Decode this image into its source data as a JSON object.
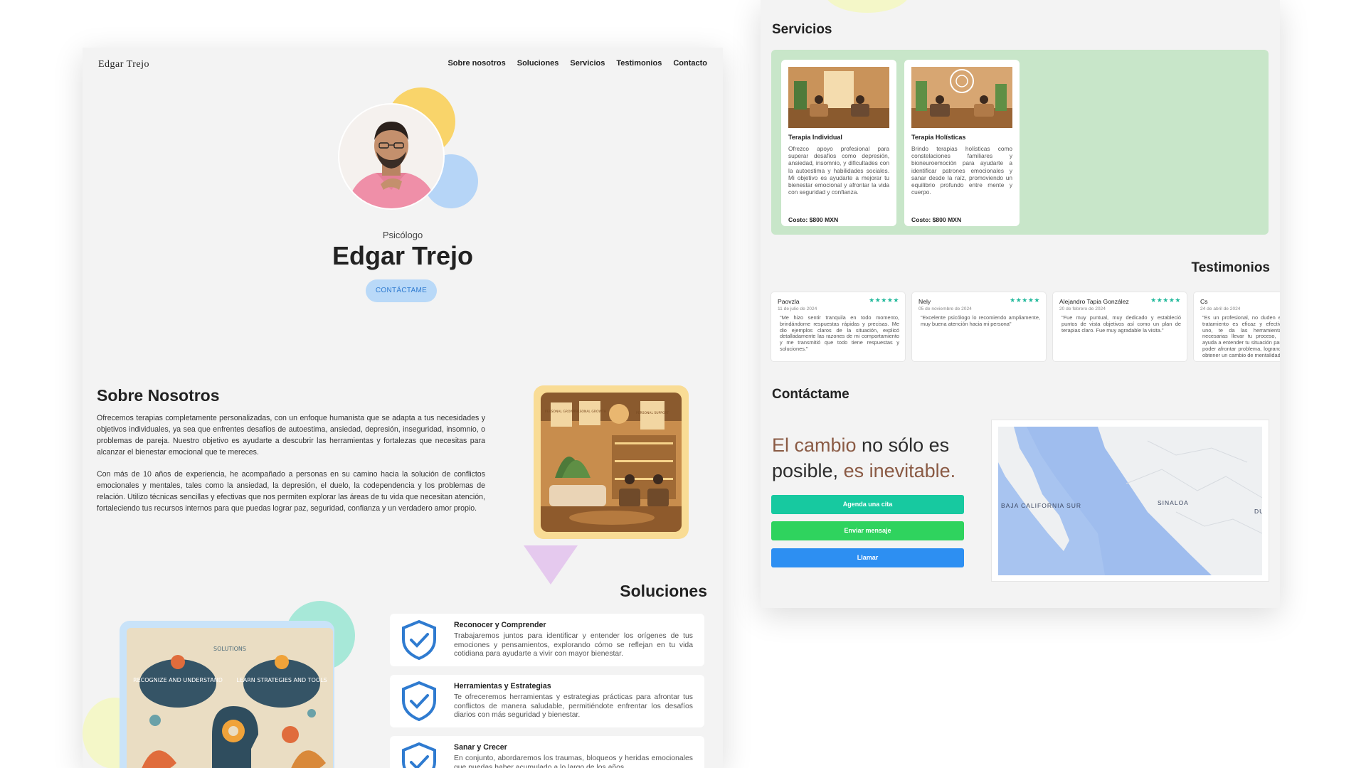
{
  "left": {
    "logo": "Edgar Trejo",
    "nav": [
      "Sobre nosotros",
      "Soluciones",
      "Servicios",
      "Testimonios",
      "Contacto"
    ],
    "hero": {
      "role": "Psicólogo",
      "name": "Edgar Trejo",
      "button": "CONTÁCTAME"
    },
    "about": {
      "title": "Sobre Nosotros",
      "p1": "Ofrecemos terapias completamente personalizadas, con un enfoque humanista que se adapta a tus necesidades y objetivos individuales, ya sea que enfrentes desafíos de autoestima, ansiedad, depresión, inseguridad, insomnio, o problemas de pareja. Nuestro objetivo es ayudarte a descubrir las herramientas y fortalezas que necesitas para alcanzar el bienestar emocional que te mereces.",
      "p2": "Con más de 10 años de experiencia, he acompañado a personas en su camino hacia la solución de conflictos emocionales y mentales, tales como la ansiedad, la depresión, el duelo, la codependencia y los problemas de relación. Utilizo técnicas sencillas y efectivas que nos permiten explorar las áreas de tu vida que necesitan atención, fortaleciendo tus recursos internos para que puedas lograr paz, seguridad, confianza y un verdadero amor propio.",
      "image_signs": [
        "PERSONAL GROWTH",
        "PERSONAL GROWTH",
        "PERSONAL SUPPORT"
      ]
    },
    "solutions": {
      "title": "Soluciones",
      "poster": {
        "heading": "SOLUTIONS",
        "left": "RECOGNIZE AND UNDERSTAND",
        "right": "LEARN STRATEGIES AND TOOLS"
      },
      "items": [
        {
          "title": "Reconocer y Comprender",
          "text": "Trabajaremos juntos para identificar y entender los orígenes de tus emociones y pensamientos, explorando cómo se reflejan en tu vida cotidiana para ayudarte a vivir con mayor bienestar."
        },
        {
          "title": "Herramientas y Estrategias",
          "text": "Te ofreceremos herramientas y estrategias prácticas para afrontar tus conflictos de manera saludable, permitiéndote enfrentar los desafíos diarios con más seguridad y bienestar."
        },
        {
          "title": "Sanar y Crecer",
          "text": "En conjunto, abordaremos los traumas, bloqueos y heridas emocionales que puedas haber acumulado a lo largo de los años."
        }
      ]
    }
  },
  "right": {
    "services": {
      "title": "Servicios",
      "items": [
        {
          "title": "Terapia Individual",
          "text": "Ofrezco apoyo profesional para superar desafíos como depresión, ansiedad, insomnio, y dificultades con la autoestima y habilidades sociales. Mi objetivo es ayudarte a mejorar tu bienestar emocional y afrontar la vida con seguridad y confianza.",
          "cost": "Costo: $800 MXN"
        },
        {
          "title": "Terapia Holísticas",
          "text": "Brindo terapias holísticas como constelaciones familiares y bioneuroemoción para ayudarte a identificar patrones emocionales y sanar desde la raíz, promoviendo un equilibrio profundo entre mente y cuerpo.",
          "cost": "Costo: $800 MXN"
        }
      ]
    },
    "testimonials": {
      "title": "Testimonios",
      "stars": "★★★★★",
      "items": [
        {
          "name": "Paovzla",
          "date": "11 de julio de 2024",
          "text": "\"Me hizo sentir tranquila en todo momento, brindándome respuestas rápidas y precisas. Me dio ejemplos claros de la situación, explicó detalladamente las razones de mi comportamiento y me transmitió que todo tiene respuestas y soluciones.\""
        },
        {
          "name": "Nely",
          "date": "05 de noviembre de 2024",
          "text": "\"Excelente psicólogo lo recomiendo ampliamente, muy buena atención hacia mi persona\""
        },
        {
          "name": "Alejandro Tapia González",
          "date": "20 de febrero de 2024",
          "text": "\"Fue muy puntual, muy dedicado y estableció puntos de vista objetivos así como un plan de terapias claro. Fue muy agradable la visita.\""
        },
        {
          "name": "Cs",
          "date": "24 de abril de 2024",
          "text": "\"Es un profesional, no duden en tratamiento es eficaz y efectivo uno, te da las herramientas necesarias llevar tu proceso, te ayuda a entender tu situación para poder afrontar problema, logrando obtener un cambio de mentalidad.\""
        }
      ]
    },
    "contact": {
      "title": "Contáctame",
      "slogan": {
        "a1": "El cambio",
        "b1": " no sólo es posible, ",
        "a2": "es inevitable."
      },
      "buttons": [
        "Agenda una cita",
        "Enviar mensaje",
        "Llamar"
      ],
      "map_labels": [
        "BAJA CALIFORNIA SUR",
        "SINALOA",
        "DU"
      ]
    }
  },
  "colors": {
    "services_bg": "#c8e6c9",
    "accent_brown": "#8a5a44",
    "btn_teal": "#17c9a0",
    "btn_green": "#2fd35e",
    "btn_blue": "#2d8ff2",
    "stars": "#1fb89a"
  }
}
